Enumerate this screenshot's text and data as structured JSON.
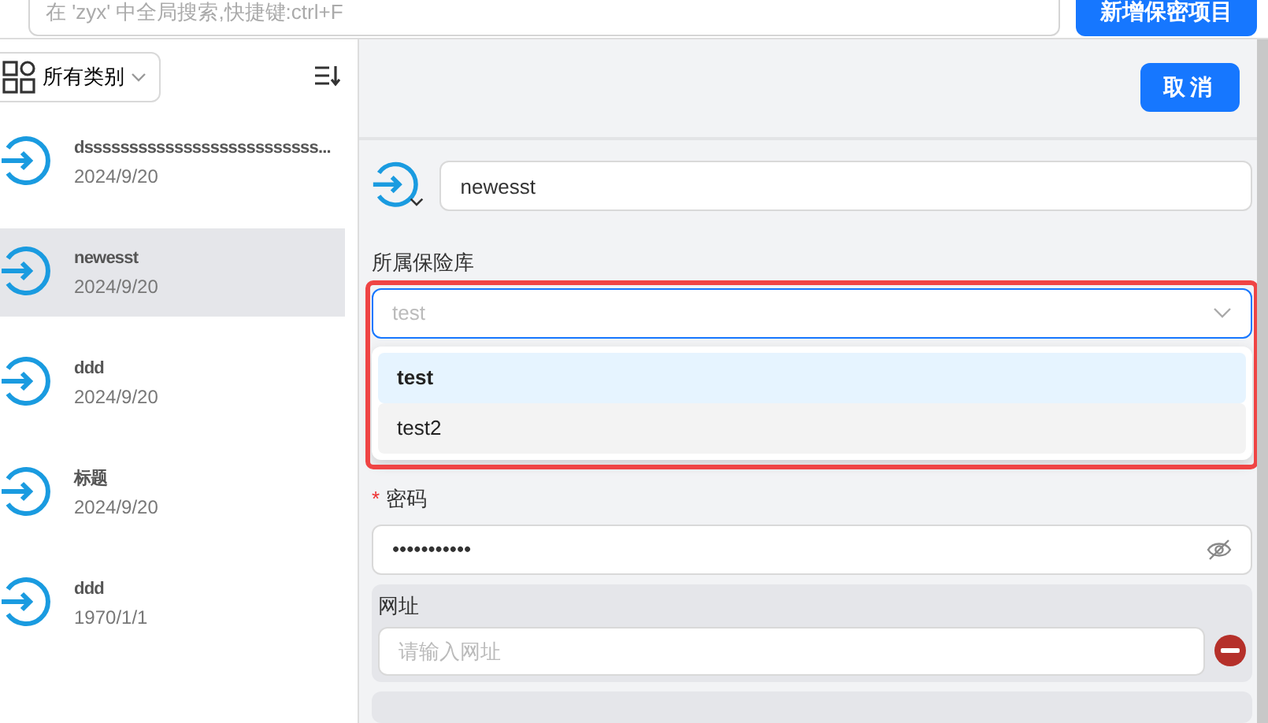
{
  "search": {
    "placeholder": "在 'zyx' 中全局搜索,快捷键:ctrl+F"
  },
  "add_button": "新增保密项目",
  "category_filter": {
    "value": "所有类别"
  },
  "items": [
    {
      "title": "dssssssssssssssssssssssssss...",
      "date": "2024/9/20",
      "selected": false
    },
    {
      "title": "newesst",
      "date": "2024/9/20",
      "selected": true
    },
    {
      "title": "ddd",
      "date": "2024/9/20",
      "selected": false
    },
    {
      "title": "标题",
      "date": "2024/9/20",
      "selected": false
    },
    {
      "title": "ddd",
      "date": "1970/1/1",
      "selected": false
    }
  ],
  "cancel_button": "取消",
  "name_field": {
    "value": "newesst"
  },
  "vault": {
    "label": "所属保险库",
    "placeholder": "test",
    "expanded": true,
    "options": [
      {
        "label": "test",
        "selected": true,
        "hovered": false
      },
      {
        "label": "test2",
        "selected": false,
        "hovered": true
      }
    ]
  },
  "password": {
    "label": "密码",
    "required_mark": "*",
    "value": "•••••••••••"
  },
  "url": {
    "label": "网址",
    "placeholder": "请输入网址"
  }
}
